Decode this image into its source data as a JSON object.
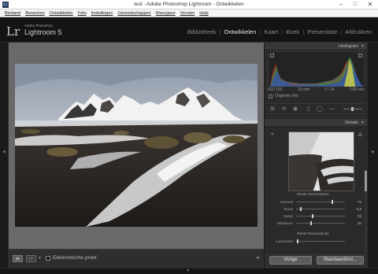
{
  "window": {
    "title": "test - Adobe Photoshop Lightroom - Ontwikkelen",
    "minimize": "–",
    "maximize": "□",
    "close": "✕"
  },
  "menu": [
    "Bestand",
    "Bewerken",
    "Ontwikkelen",
    "Foto",
    "Instellingen",
    "Gereedschappen",
    "Weergave",
    "Venster",
    "Help"
  ],
  "identity": {
    "logo": "Lr",
    "adobe": "Adobe Photoshop",
    "product": "Lightroom 5"
  },
  "modules": [
    {
      "label": "Bibliotheek",
      "active": false
    },
    {
      "label": "Ontwikkelen",
      "active": true
    },
    {
      "label": "Kaart",
      "active": false
    },
    {
      "label": "Boek",
      "active": false
    },
    {
      "label": "Presentatie",
      "active": false
    },
    {
      "label": "Afdrukken",
      "active": false
    }
  ],
  "toolbar": {
    "soft_proof_label": "Elektronische proef"
  },
  "histogram": {
    "title": "Histogram",
    "iso": "ISO 100",
    "focal": "16 mm",
    "aperture": "f / 14",
    "shutter": "1/30 sec",
    "original_photo_label": "Originele foto"
  },
  "details": {
    "title": "Details",
    "sharpen_title": "Reset Verscherpen",
    "noise_title": "Reset Ruisreductie",
    "sliders": [
      {
        "label": "Hoeveel",
        "value": "70"
      },
      {
        "label": "Straal",
        "value": "0,8"
      },
      {
        "label": "Detail",
        "value": "33"
      },
      {
        "label": "Maskeren",
        "value": "30"
      }
    ],
    "luminance_label": "Luminantie"
  },
  "buttons": {
    "previous": "Vorige",
    "reset": "Standaardinst..."
  },
  "icons": {
    "left_panel_toggle": "◀",
    "right_panel_toggle": "▶",
    "filmstrip_toggle": "▼",
    "panel_collapse": "▼"
  }
}
